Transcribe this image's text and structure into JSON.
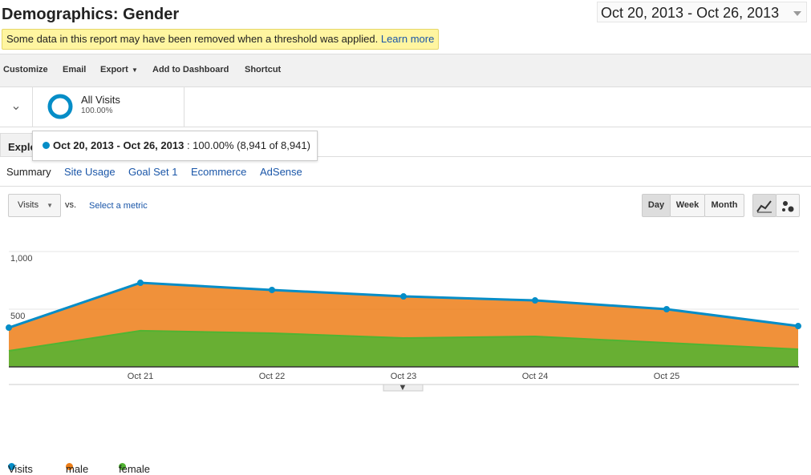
{
  "header": {
    "title": "Demographics: Gender",
    "date_range": "Oct 20, 2013 - Oct 26, 2013"
  },
  "notice": {
    "text": "Some data in this report may have been removed when a threshold was applied.",
    "link": "Learn more"
  },
  "toolbar": {
    "customize": "Customize",
    "email": "Email",
    "export": "Export",
    "add_dashboard": "Add to Dashboard",
    "shortcut": "Shortcut"
  },
  "segment": {
    "name": "All Visits",
    "percent": "100.00%"
  },
  "tooltip": {
    "range": "Oct 20, 2013 - Oct 26, 2013",
    "value": ": 100.00% (8,941 of 8,941)"
  },
  "tabs": {
    "explorer": "Explo"
  },
  "subtabs": [
    "Summary",
    "Site Usage",
    "Goal Set 1",
    "Ecommerce",
    "AdSense"
  ],
  "controls": {
    "metric": "Visits",
    "vs": "vs.",
    "select_metric": "Select a metric",
    "day": "Day",
    "week": "Week",
    "month": "Month"
  },
  "colors": {
    "visits": "#058dc7",
    "male": "#ed7e17",
    "female": "#50b432"
  },
  "chart_data": {
    "type": "area",
    "categories": [
      "Oct 20",
      "Oct 21",
      "Oct 22",
      "Oct 23",
      "Oct 24",
      "Oct 25",
      "Oct 26"
    ],
    "tick_labels": [
      "Oct 21",
      "Oct 22",
      "Oct 23",
      "Oct 24",
      "Oct 25"
    ],
    "y_ticks": [
      "1,000",
      "500"
    ],
    "ylim": [
      0,
      1000
    ],
    "series": [
      {
        "name": "Visits",
        "values": [
          340,
          729,
          667,
          611,
          576,
          500,
          354
        ]
      },
      {
        "name": "male",
        "values": [
          201,
          416,
          375,
          361,
          312,
          292,
          201
        ]
      },
      {
        "name": "female",
        "values": [
          139,
          313,
          292,
          250,
          264,
          208,
          153
        ]
      }
    ],
    "grid": true,
    "legend": "top-left"
  }
}
